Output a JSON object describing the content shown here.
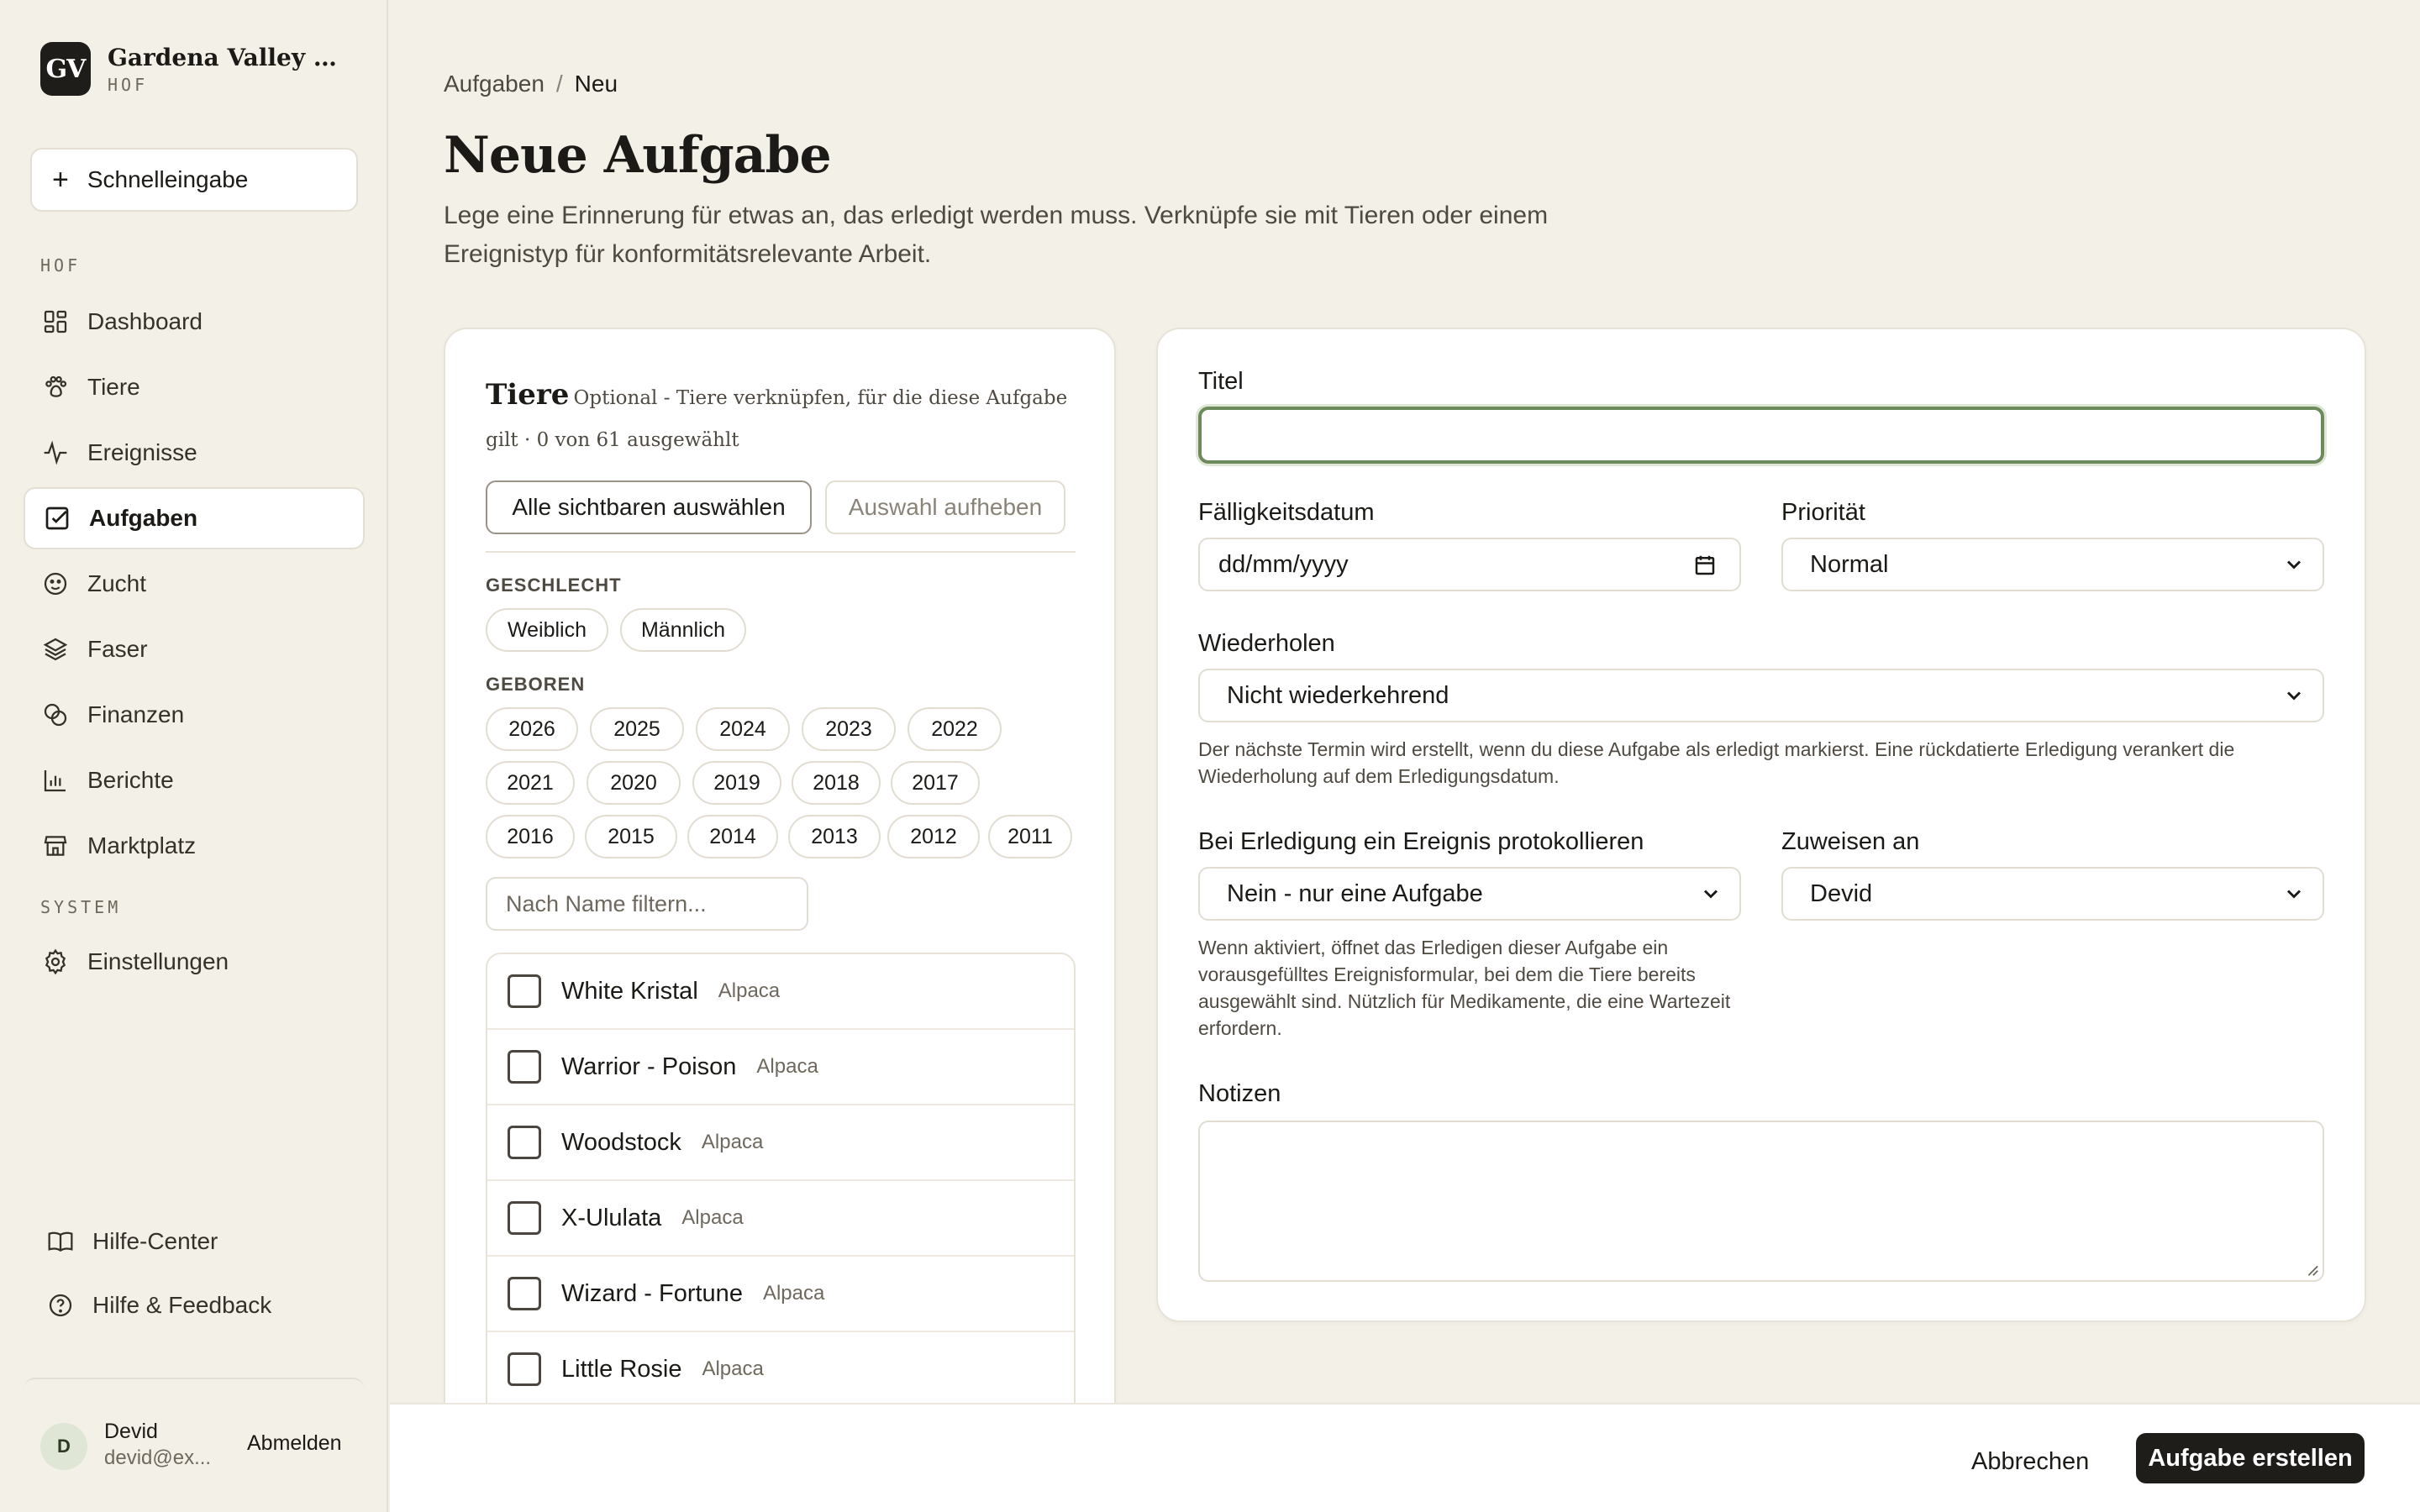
{
  "brand": {
    "logo": "GV",
    "name": "Gardena Valley Alp...",
    "sub": "HOF"
  },
  "quick_entry": {
    "label": "Schnelleingabe"
  },
  "nav": {
    "section_hof": "HOF",
    "section_system": "SYSTEM",
    "items": [
      {
        "label": "Dashboard",
        "icon": "grid-icon"
      },
      {
        "label": "Tiere",
        "icon": "paw-icon"
      },
      {
        "label": "Ereignisse",
        "icon": "activity-icon"
      },
      {
        "label": "Aufgaben",
        "icon": "checkbox-icon",
        "active": true
      },
      {
        "label": "Zucht",
        "icon": "face-icon"
      },
      {
        "label": "Faser",
        "icon": "layers-icon"
      },
      {
        "label": "Finanzen",
        "icon": "coins-icon"
      },
      {
        "label": "Berichte",
        "icon": "bar-chart-icon"
      },
      {
        "label": "Marktplatz",
        "icon": "store-icon"
      }
    ],
    "settings": {
      "label": "Einstellungen",
      "icon": "gear-icon"
    }
  },
  "help": {
    "center": "Hilfe-Center",
    "feedback": "Hilfe & Feedback"
  },
  "user": {
    "initial": "D",
    "name": "Devid",
    "email": "devid@ex...",
    "logout": "Abmelden"
  },
  "breadcrumb": {
    "parent": "Aufgaben",
    "sep": "/",
    "current": "Neu"
  },
  "page": {
    "title": "Neue Aufgabe",
    "description": "Lege eine Erinnerung für etwas an, das erledigt werden muss. Verknüpfe sie mit Tieren oder einem Ereignistyp für konformitätsrelevante Arbeit."
  },
  "animals": {
    "title": "Tiere",
    "subtitle": "Optional - Tiere verknüpfen, für die diese Aufgabe gilt · 0 von 61 ausgewählt",
    "select_all": "Alle sichtbaren auswählen",
    "clear": "Auswahl aufheben",
    "gender_label": "GESCHLECHT",
    "genders": [
      "Weiblich",
      "Männlich"
    ],
    "born_label": "GEBOREN",
    "years": [
      "2026",
      "2025",
      "2024",
      "2023",
      "2022",
      "2021",
      "2020",
      "2019",
      "2018",
      "2017",
      "2016",
      "2015",
      "2014",
      "2013",
      "2012",
      "2011"
    ],
    "filter_placeholder": "Nach Name filtern...",
    "list": [
      {
        "name": "White Kristal",
        "species": "Alpaca"
      },
      {
        "name": "Warrior - Poison",
        "species": "Alpaca"
      },
      {
        "name": "Woodstock",
        "species": "Alpaca"
      },
      {
        "name": "X-Ululata",
        "species": "Alpaca"
      },
      {
        "name": "Wizard - Fortune",
        "species": "Alpaca"
      },
      {
        "name": "Little Rosie",
        "species": "Alpaca"
      }
    ]
  },
  "form": {
    "title_label": "Titel",
    "title_value": "",
    "due_label": "Fälligkeitsdatum",
    "due_placeholder": "dd/mm/yyyy",
    "priority_label": "Priorität",
    "priority_value": "Normal",
    "repeat_label": "Wiederholen",
    "repeat_value": "Nicht wiederkehrend",
    "repeat_hint": "Der nächste Termin wird erstellt, wenn du diese Aufgabe als erledigt markierst. Eine rückdatierte Erledigung verankert die Wiederholung auf dem Erledigungsdatum.",
    "log_label": "Bei Erledigung ein Ereignis protokollieren",
    "log_value": "Nein - nur eine Aufgabe",
    "log_hint": "Wenn aktiviert, öffnet das Erledigen dieser Aufgabe ein vorausgefülltes Ereignisformular, bei dem die Tiere bereits ausgewählt sind. Nützlich für Medikamente, die eine Wartezeit erfordern.",
    "assign_label": "Zuweisen an",
    "assign_value": "Devid",
    "notes_label": "Notizen"
  },
  "footer": {
    "cancel": "Abbrechen",
    "create": "Aufgabe erstellen"
  },
  "colors": {
    "accent_green": "#6c8a5c",
    "dark": "#1f1d19",
    "background": "#f3f0e8"
  }
}
